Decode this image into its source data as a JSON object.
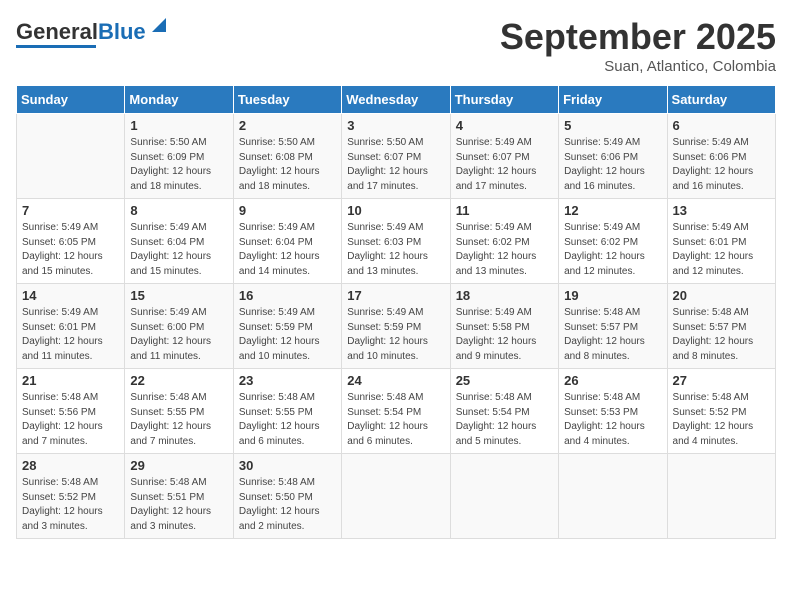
{
  "header": {
    "logo_line1": "General",
    "logo_line2": "Blue",
    "month_title": "September 2025",
    "subtitle": "Suan, Atlantico, Colombia"
  },
  "days_of_week": [
    "Sunday",
    "Monday",
    "Tuesday",
    "Wednesday",
    "Thursday",
    "Friday",
    "Saturday"
  ],
  "weeks": [
    [
      {
        "day": "",
        "info": ""
      },
      {
        "day": "1",
        "info": "Sunrise: 5:50 AM\nSunset: 6:09 PM\nDaylight: 12 hours\nand 18 minutes."
      },
      {
        "day": "2",
        "info": "Sunrise: 5:50 AM\nSunset: 6:08 PM\nDaylight: 12 hours\nand 18 minutes."
      },
      {
        "day": "3",
        "info": "Sunrise: 5:50 AM\nSunset: 6:07 PM\nDaylight: 12 hours\nand 17 minutes."
      },
      {
        "day": "4",
        "info": "Sunrise: 5:49 AM\nSunset: 6:07 PM\nDaylight: 12 hours\nand 17 minutes."
      },
      {
        "day": "5",
        "info": "Sunrise: 5:49 AM\nSunset: 6:06 PM\nDaylight: 12 hours\nand 16 minutes."
      },
      {
        "day": "6",
        "info": "Sunrise: 5:49 AM\nSunset: 6:06 PM\nDaylight: 12 hours\nand 16 minutes."
      }
    ],
    [
      {
        "day": "7",
        "info": "Sunrise: 5:49 AM\nSunset: 6:05 PM\nDaylight: 12 hours\nand 15 minutes."
      },
      {
        "day": "8",
        "info": "Sunrise: 5:49 AM\nSunset: 6:04 PM\nDaylight: 12 hours\nand 15 minutes."
      },
      {
        "day": "9",
        "info": "Sunrise: 5:49 AM\nSunset: 6:04 PM\nDaylight: 12 hours\nand 14 minutes."
      },
      {
        "day": "10",
        "info": "Sunrise: 5:49 AM\nSunset: 6:03 PM\nDaylight: 12 hours\nand 13 minutes."
      },
      {
        "day": "11",
        "info": "Sunrise: 5:49 AM\nSunset: 6:02 PM\nDaylight: 12 hours\nand 13 minutes."
      },
      {
        "day": "12",
        "info": "Sunrise: 5:49 AM\nSunset: 6:02 PM\nDaylight: 12 hours\nand 12 minutes."
      },
      {
        "day": "13",
        "info": "Sunrise: 5:49 AM\nSunset: 6:01 PM\nDaylight: 12 hours\nand 12 minutes."
      }
    ],
    [
      {
        "day": "14",
        "info": "Sunrise: 5:49 AM\nSunset: 6:01 PM\nDaylight: 12 hours\nand 11 minutes."
      },
      {
        "day": "15",
        "info": "Sunrise: 5:49 AM\nSunset: 6:00 PM\nDaylight: 12 hours\nand 11 minutes."
      },
      {
        "day": "16",
        "info": "Sunrise: 5:49 AM\nSunset: 5:59 PM\nDaylight: 12 hours\nand 10 minutes."
      },
      {
        "day": "17",
        "info": "Sunrise: 5:49 AM\nSunset: 5:59 PM\nDaylight: 12 hours\nand 10 minutes."
      },
      {
        "day": "18",
        "info": "Sunrise: 5:49 AM\nSunset: 5:58 PM\nDaylight: 12 hours\nand 9 minutes."
      },
      {
        "day": "19",
        "info": "Sunrise: 5:48 AM\nSunset: 5:57 PM\nDaylight: 12 hours\nand 8 minutes."
      },
      {
        "day": "20",
        "info": "Sunrise: 5:48 AM\nSunset: 5:57 PM\nDaylight: 12 hours\nand 8 minutes."
      }
    ],
    [
      {
        "day": "21",
        "info": "Sunrise: 5:48 AM\nSunset: 5:56 PM\nDaylight: 12 hours\nand 7 minutes."
      },
      {
        "day": "22",
        "info": "Sunrise: 5:48 AM\nSunset: 5:55 PM\nDaylight: 12 hours\nand 7 minutes."
      },
      {
        "day": "23",
        "info": "Sunrise: 5:48 AM\nSunset: 5:55 PM\nDaylight: 12 hours\nand 6 minutes."
      },
      {
        "day": "24",
        "info": "Sunrise: 5:48 AM\nSunset: 5:54 PM\nDaylight: 12 hours\nand 6 minutes."
      },
      {
        "day": "25",
        "info": "Sunrise: 5:48 AM\nSunset: 5:54 PM\nDaylight: 12 hours\nand 5 minutes."
      },
      {
        "day": "26",
        "info": "Sunrise: 5:48 AM\nSunset: 5:53 PM\nDaylight: 12 hours\nand 4 minutes."
      },
      {
        "day": "27",
        "info": "Sunrise: 5:48 AM\nSunset: 5:52 PM\nDaylight: 12 hours\nand 4 minutes."
      }
    ],
    [
      {
        "day": "28",
        "info": "Sunrise: 5:48 AM\nSunset: 5:52 PM\nDaylight: 12 hours\nand 3 minutes."
      },
      {
        "day": "29",
        "info": "Sunrise: 5:48 AM\nSunset: 5:51 PM\nDaylight: 12 hours\nand 3 minutes."
      },
      {
        "day": "30",
        "info": "Sunrise: 5:48 AM\nSunset: 5:50 PM\nDaylight: 12 hours\nand 2 minutes."
      },
      {
        "day": "",
        "info": ""
      },
      {
        "day": "",
        "info": ""
      },
      {
        "day": "",
        "info": ""
      },
      {
        "day": "",
        "info": ""
      }
    ]
  ]
}
